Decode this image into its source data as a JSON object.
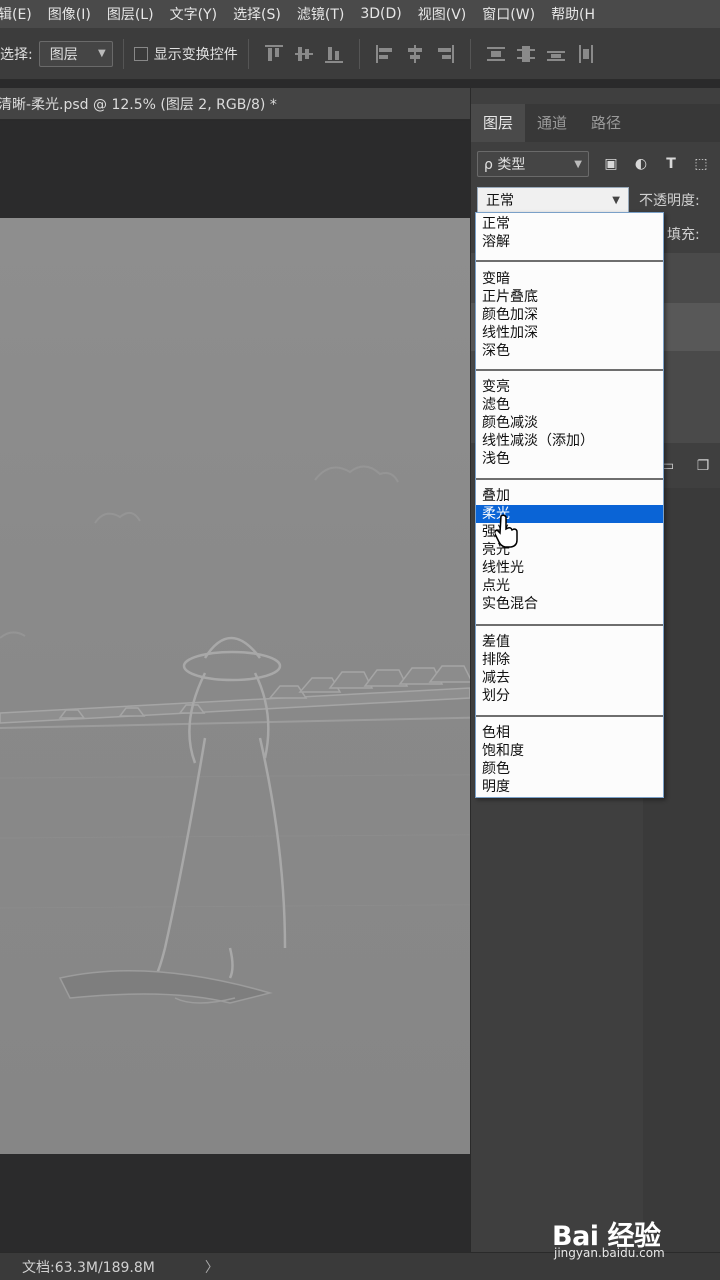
{
  "menubar": {
    "items": [
      "辑(E)",
      "图像(I)",
      "图层(L)",
      "文字(Y)",
      "选择(S)",
      "滤镜(T)",
      "3D(D)",
      "视图(V)",
      "窗口(W)",
      "帮助(H"
    ]
  },
  "options": {
    "select_label": "选择:",
    "select_value": "图层",
    "show_transform_label": "显示变换控件"
  },
  "document": {
    "tab_title": "清晰-柔光.psd @ 12.5% (图层 2, RGB/8) *"
  },
  "layers_panel": {
    "tabs": [
      "图层",
      "通道",
      "路径"
    ],
    "filter_label": "ρ 类型",
    "blend_mode": "正常",
    "opacity_label": "不透明度:",
    "fill_label": "填充:"
  },
  "blend_menu": {
    "groups": [
      [
        "正常",
        "溶解"
      ],
      [
        "变暗",
        "正片叠底",
        "颜色加深",
        "线性加深",
        "深色"
      ],
      [
        "变亮",
        "滤色",
        "颜色减淡",
        "线性减淡（添加）",
        "浅色"
      ],
      [
        "叠加",
        "柔光",
        "强光",
        "亮光",
        "线性光",
        "点光",
        "实色混合"
      ],
      [
        "差值",
        "排除",
        "减去",
        "划分"
      ],
      [
        "色相",
        "饱和度",
        "颜色",
        "明度"
      ]
    ],
    "selected": "柔光"
  },
  "status": {
    "doc_info": "文档:63.3M/189.8M",
    "arrow": "〉"
  },
  "watermark": {
    "brand": "Bai 经验",
    "url": "jingyan.baidu.com"
  },
  "colors": {
    "selection": "#0a64d6",
    "panel_bg": "#3f3f3f",
    "menubar_bg": "#4a4a4a"
  }
}
